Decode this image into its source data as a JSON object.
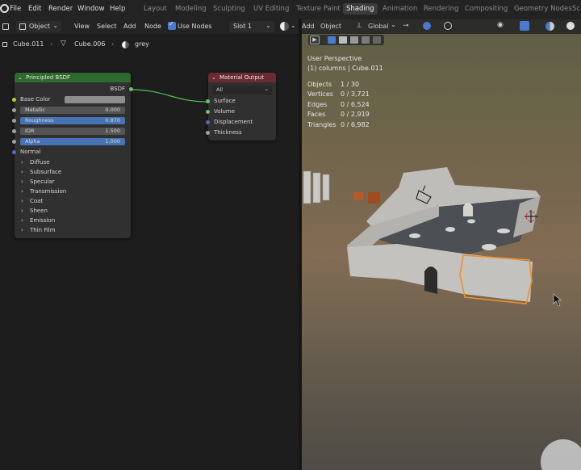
{
  "topbar": {
    "menus": [
      "File",
      "Edit",
      "Render",
      "Window",
      "Help"
    ],
    "workspaces": [
      "Layout",
      "Modeling",
      "Sculpting",
      "UV Editing",
      "Texture Paint",
      "Shading",
      "Animation",
      "Rendering",
      "Compositing",
      "Geometry Nodes",
      "Sc"
    ],
    "active_workspace": "Shading"
  },
  "node_editor": {
    "mode": "Object",
    "menus": [
      "View",
      "Select",
      "Add",
      "Node"
    ],
    "use_nodes_label": "Use Nodes",
    "slot": "Slot 1",
    "breadcrumb": [
      "Cube.011",
      "Cube.006",
      "grey"
    ]
  },
  "bsdf_node": {
    "title": "Principled BSDF",
    "output": "BSDF",
    "base_color_label": "Base Color",
    "fields": [
      {
        "label": "Metallic",
        "value": "0.000",
        "highlighted": false
      },
      {
        "label": "Roughness",
        "value": "0.870",
        "highlighted": true
      },
      {
        "label": "IOR",
        "value": "1.500",
        "highlighted": false
      },
      {
        "label": "Alpha",
        "value": "1.000",
        "highlighted": true
      }
    ],
    "normal_label": "Normal",
    "panels": [
      "Diffuse",
      "Subsurface",
      "Specular",
      "Transmission",
      "Coat",
      "Sheen",
      "Emission",
      "Thin Film"
    ]
  },
  "output_node": {
    "title": "Material Output",
    "target": "All",
    "inputs": [
      "Surface",
      "Volume",
      "Displacement",
      "Thickness"
    ]
  },
  "viewport": {
    "menus": [
      "Add",
      "Object"
    ],
    "orientation": "Global",
    "view_name": "User Perspective",
    "object_info": "(1) columns | Cube.011",
    "stats": [
      {
        "label": "Objects",
        "value": "1 / 30"
      },
      {
        "label": "Vertices",
        "value": "0 / 3,721"
      },
      {
        "label": "Edges",
        "value": "0 / 6,524"
      },
      {
        "label": "Faces",
        "value": "0 / 2,919"
      },
      {
        "label": "Triangles",
        "value": "0 / 6,982"
      }
    ]
  },
  "colors": {
    "bsdf_header": "#2e6a2e",
    "output_header": "#6a2a33",
    "highlight_field": "#4772b3",
    "selection_orange": "#f0902a",
    "socket_yellow": "#c7c729",
    "socket_grey": "#a1a1a1",
    "socket_blue": "#6363c7",
    "socket_green": "#63c763"
  }
}
